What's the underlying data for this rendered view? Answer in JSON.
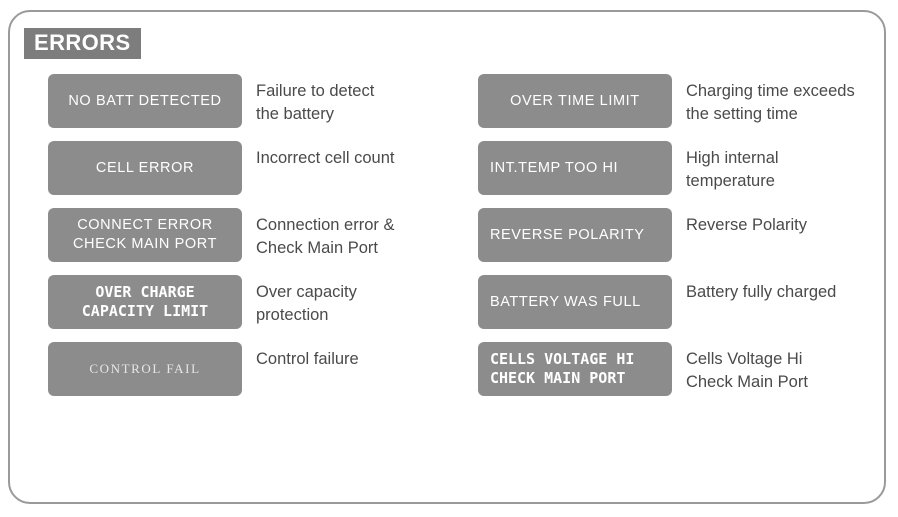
{
  "panel": {
    "badge_label": "ERRORS",
    "badge_bg": "#7d7d7d",
    "chip_bg": "#8c8c8c",
    "chip_text_color": "#ffffff",
    "desc_text_color": "#4a4a4a",
    "border_color": "#9a9a9a"
  },
  "columns": {
    "left": [
      {
        "display_style": "sans",
        "display_lines": [
          "NO BATT DETECTED"
        ],
        "description_lines": [
          "Failure to detect",
          "the battery"
        ]
      },
      {
        "display_style": "sans",
        "display_lines": [
          "CELL ERROR"
        ],
        "description_lines": [
          "Incorrect cell count"
        ]
      },
      {
        "display_style": "sans",
        "display_lines": [
          "CONNECT ERROR",
          "CHECK MAIN PORT"
        ],
        "description_lines": [
          "Connection error &",
          "Check Main Port"
        ]
      },
      {
        "display_style": "dot",
        "display_lines": [
          "OVER CHARGE",
          "CAPACITY LIMIT"
        ],
        "description_lines": [
          "Over capacity",
          "protection"
        ]
      },
      {
        "display_style": "serif",
        "display_lines": [
          "CONTROL FAIL"
        ],
        "description_lines": [
          "Control failure"
        ]
      }
    ],
    "right": [
      {
        "display_style": "sans",
        "display_lines": [
          "OVER TIME LIMIT"
        ],
        "description_lines": [
          "Charging time exceeds",
          "the setting time"
        ]
      },
      {
        "display_style": "sans-left",
        "display_lines": [
          "INT.TEMP TOO HI"
        ],
        "description_lines": [
          "High internal",
          "temperature"
        ]
      },
      {
        "display_style": "sans-left",
        "display_lines": [
          "REVERSE POLARITY"
        ],
        "description_lines": [
          "Reverse Polarity"
        ]
      },
      {
        "display_style": "sans-left",
        "display_lines": [
          "BATTERY WAS FULL"
        ],
        "description_lines": [
          "Battery fully charged"
        ]
      },
      {
        "display_style": "dot-left",
        "display_lines": [
          "CELLS VOLTAGE HI",
          "CHECK MAIN PORT"
        ],
        "description_lines": [
          "Cells Voltage Hi",
          "Check Main Port"
        ]
      }
    ]
  }
}
